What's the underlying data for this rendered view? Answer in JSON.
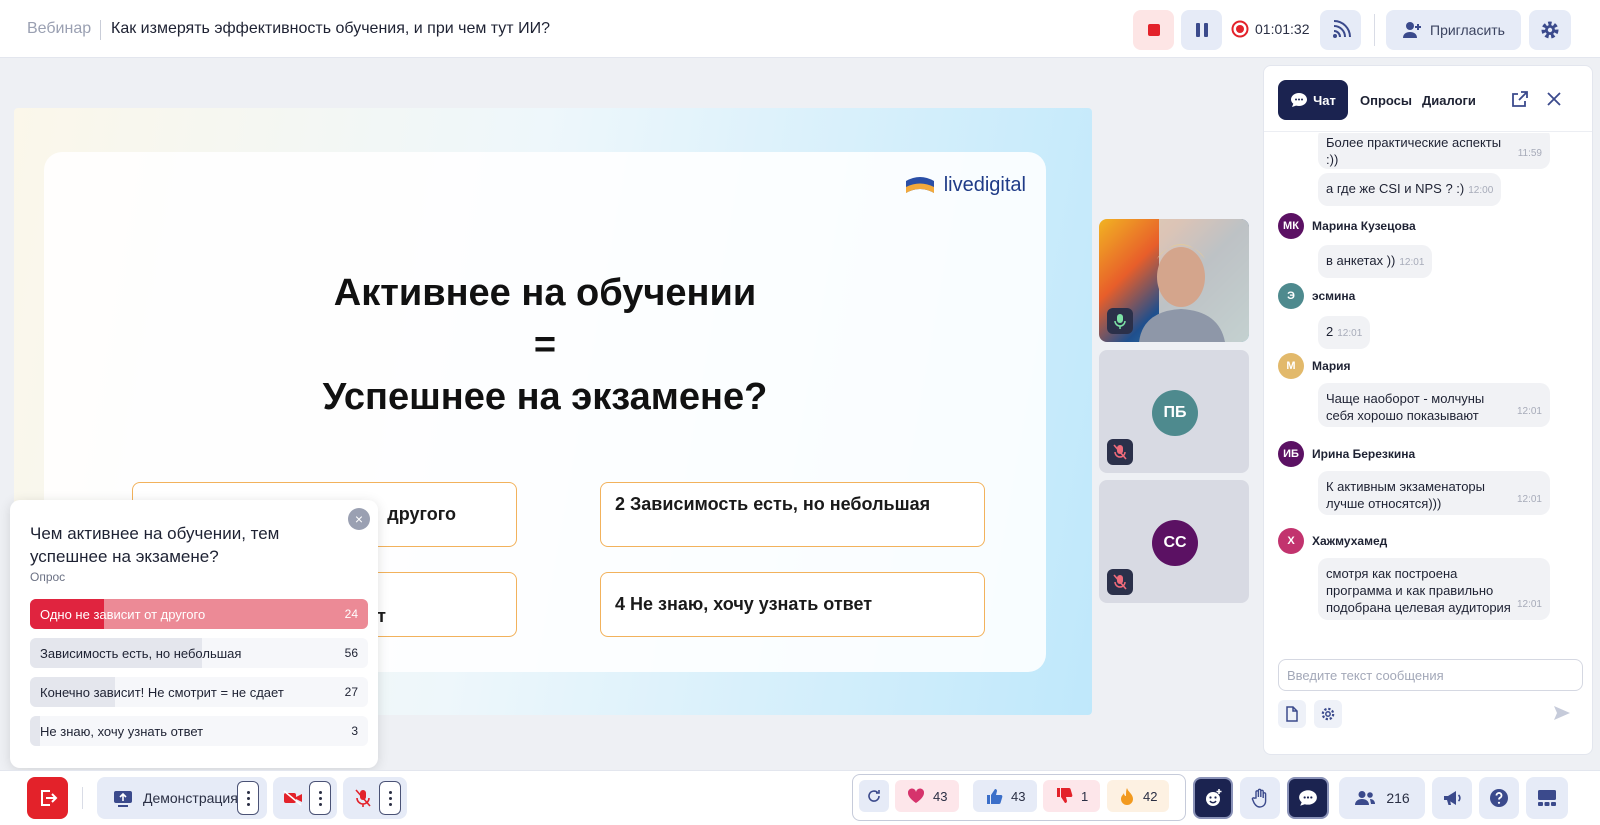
{
  "header": {
    "crumb": "Вебинар",
    "title": "Как измерять эффективность обучения, и при чем тут ИИ?",
    "timer": "01:01:32",
    "invite_label": "Пригласить"
  },
  "slide": {
    "logo_text": "livedigital",
    "line1": "Активнее на обучении",
    "line2": "=",
    "line3": "Успешнее на экзамене?",
    "option_1": "другого",
    "option_2": "2 Зависимость есть, но небольшая",
    "option_3": "т",
    "option_4": "4 Не знаю, хочу узнать ответ"
  },
  "tiles": [
    {
      "initials": "",
      "color": "#2b304a"
    },
    {
      "initials": "ПБ",
      "color": "#4e8a8e"
    },
    {
      "initials": "СС",
      "color": "#5b1163"
    }
  ],
  "poll": {
    "question": "Чем активнее на обучении, тем успешнее на экзамене?",
    "subtitle": "Опрос",
    "close": "×",
    "options": [
      {
        "label": "Одно не зависит от другого",
        "count": "24",
        "share": 0.22
      },
      {
        "label": "Зависимость есть, но небольшая",
        "count": "56",
        "share": 0.51
      },
      {
        "label": "Конечно зависит! Не смотрит = не сдает",
        "count": "27",
        "share": 0.25
      },
      {
        "label": "Не знаю, хочу узнать ответ",
        "count": "3",
        "share": 0.03
      }
    ]
  },
  "chat": {
    "tabs": [
      "Чат",
      "Опросы",
      "Диалоги"
    ],
    "messages": [
      {
        "text_line1": "Более практические аспекты",
        "text_line2": ":))",
        "time": "11:59"
      },
      {
        "text_line1": "а где же CSI и NPS ? :)",
        "time": "12:00"
      },
      {
        "author": "Марина Кузецова",
        "initials": "МК",
        "color": "#5b1163",
        "text_line1": "в анкетах ))",
        "time": "12:01"
      },
      {
        "author": "эсмина",
        "initials": "Э",
        "color": "#4e8a8e",
        "text_line1": "2",
        "time": "12:01"
      },
      {
        "author": "Мария",
        "initials": "М",
        "color": "#e2b96b",
        "text_line1": "Чаще наоборот - молчуны",
        "text_line2": "себя хорошо показывают",
        "time": "12:01"
      },
      {
        "author": "Ирина Березкина",
        "initials": "ИБ",
        "color": "#5b1163",
        "text_line1": "К активным экзаменаторы",
        "text_line2": "лучше относятся)))",
        "time": "12:01"
      },
      {
        "author": "Хажмухамед",
        "initials": "Х",
        "color": "#c2336e",
        "text_line1": "смотря как построена",
        "text_line2": "программа и как правильно",
        "text_line3": "подобрана целевая аудитория",
        "time": "12:01"
      }
    ],
    "input_placeholder": "Введите текст сообщения"
  },
  "toolbar": {
    "demo_label": "Демонстрация",
    "reactions": [
      {
        "icon": "heart-icon",
        "count": "43",
        "bg": "#fde6ea"
      },
      {
        "icon": "thumbs-up-icon",
        "count": "43",
        "bg": "#e6ebf7"
      },
      {
        "icon": "thumbs-down-icon",
        "count": "1",
        "bg": "#fde6ea"
      },
      {
        "icon": "fire-icon",
        "count": "42",
        "bg": "#fdf1e2"
      }
    ],
    "participants_count": "216"
  }
}
